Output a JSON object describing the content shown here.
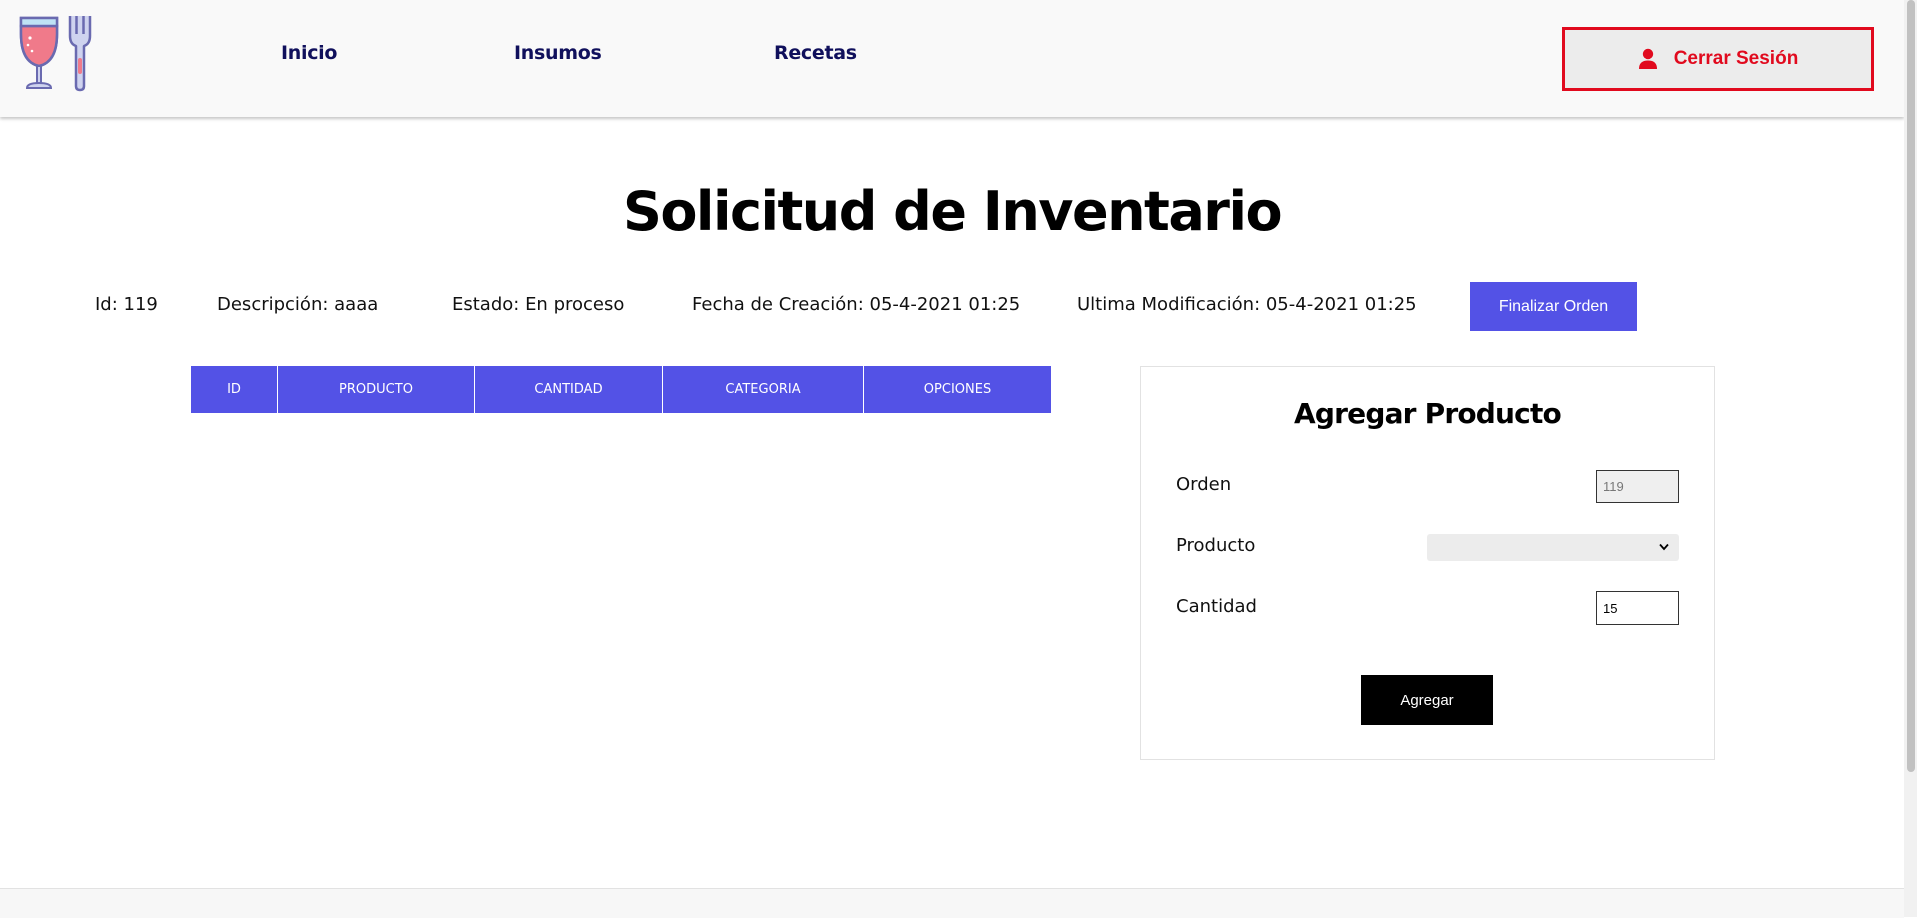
{
  "header": {
    "nav": [
      {
        "label": "Inicio"
      },
      {
        "label": "Insumos"
      },
      {
        "label": "Recetas"
      }
    ],
    "logout_label": "Cerrar Sesión"
  },
  "page": {
    "title": "Solicitud de Inventario"
  },
  "order_info": {
    "id": "Id: 119",
    "description": "Descripción: aaaa",
    "status": "Estado: En proceso",
    "created": "Fecha de Creación: 05-4-2021 01:25",
    "modified": "Ultima Modificación: 05-4-2021 01:25",
    "finalize_label": "Finalizar Orden"
  },
  "table": {
    "columns": [
      "ID",
      "PRODUCTO",
      "CANTIDAD",
      "CATEGORIA",
      "OPCIONES"
    ],
    "rows": []
  },
  "add_product": {
    "title": "Agregar Producto",
    "order_label": "Orden",
    "order_value": "119",
    "product_label": "Producto",
    "product_selected": "",
    "quantity_label": "Cantidad",
    "quantity_value": "15",
    "submit_label": "Agregar"
  },
  "colors": {
    "accent": "#5352e6",
    "nav_text": "#10105c",
    "danger": "#e10a1e"
  },
  "icons": {
    "logo": "wine-glass-fork-logo",
    "logout": "user-icon",
    "select": "chevron-down-icon"
  }
}
